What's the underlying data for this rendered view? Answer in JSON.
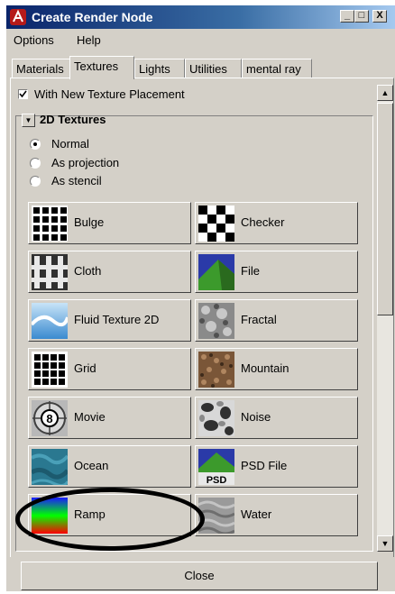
{
  "window": {
    "title": "Create Render Node",
    "minimize_glyph": "_",
    "maximize_glyph": "□",
    "close_glyph": "X"
  },
  "menu": [
    "Options",
    "Help"
  ],
  "tabs": [
    {
      "label": "Materials",
      "active": false
    },
    {
      "label": "Textures",
      "active": true
    },
    {
      "label": "Lights",
      "active": false
    },
    {
      "label": "Utilities",
      "active": false
    },
    {
      "label": "mental ray",
      "active": false
    }
  ],
  "placement_checkbox": {
    "label": "With New Texture Placement",
    "checked": true
  },
  "section": {
    "title": "2D Textures",
    "expanded": true
  },
  "modes": [
    {
      "label": "Normal",
      "selected": true
    },
    {
      "label": "As projection",
      "selected": false
    },
    {
      "label": "As stencil",
      "selected": false
    }
  ],
  "nodes": [
    {
      "label": "Bulge",
      "icon": "bulge-icon"
    },
    {
      "label": "Checker",
      "icon": "checker-icon"
    },
    {
      "label": "Cloth",
      "icon": "cloth-icon"
    },
    {
      "label": "File",
      "icon": "file-icon"
    },
    {
      "label": "Fluid Texture 2D",
      "icon": "fluid-texture-icon"
    },
    {
      "label": "Fractal",
      "icon": "fractal-icon"
    },
    {
      "label": "Grid",
      "icon": "grid-icon"
    },
    {
      "label": "Mountain",
      "icon": "mountain-icon"
    },
    {
      "label": "Movie",
      "icon": "movie-icon"
    },
    {
      "label": "Noise",
      "icon": "noise-icon"
    },
    {
      "label": "Ocean",
      "icon": "ocean-icon"
    },
    {
      "label": "PSD File",
      "icon": "psd-file-icon",
      "icon_text": "PSD"
    },
    {
      "label": "Ramp",
      "icon": "ramp-icon",
      "highlighted": true
    },
    {
      "label": "Water",
      "icon": "water-icon"
    }
  ],
  "close_label": "Close",
  "colors": {
    "face": "#d4d0c8",
    "title_start": "#0a246a",
    "title_end": "#a6caf0",
    "annotation": "#000000"
  }
}
